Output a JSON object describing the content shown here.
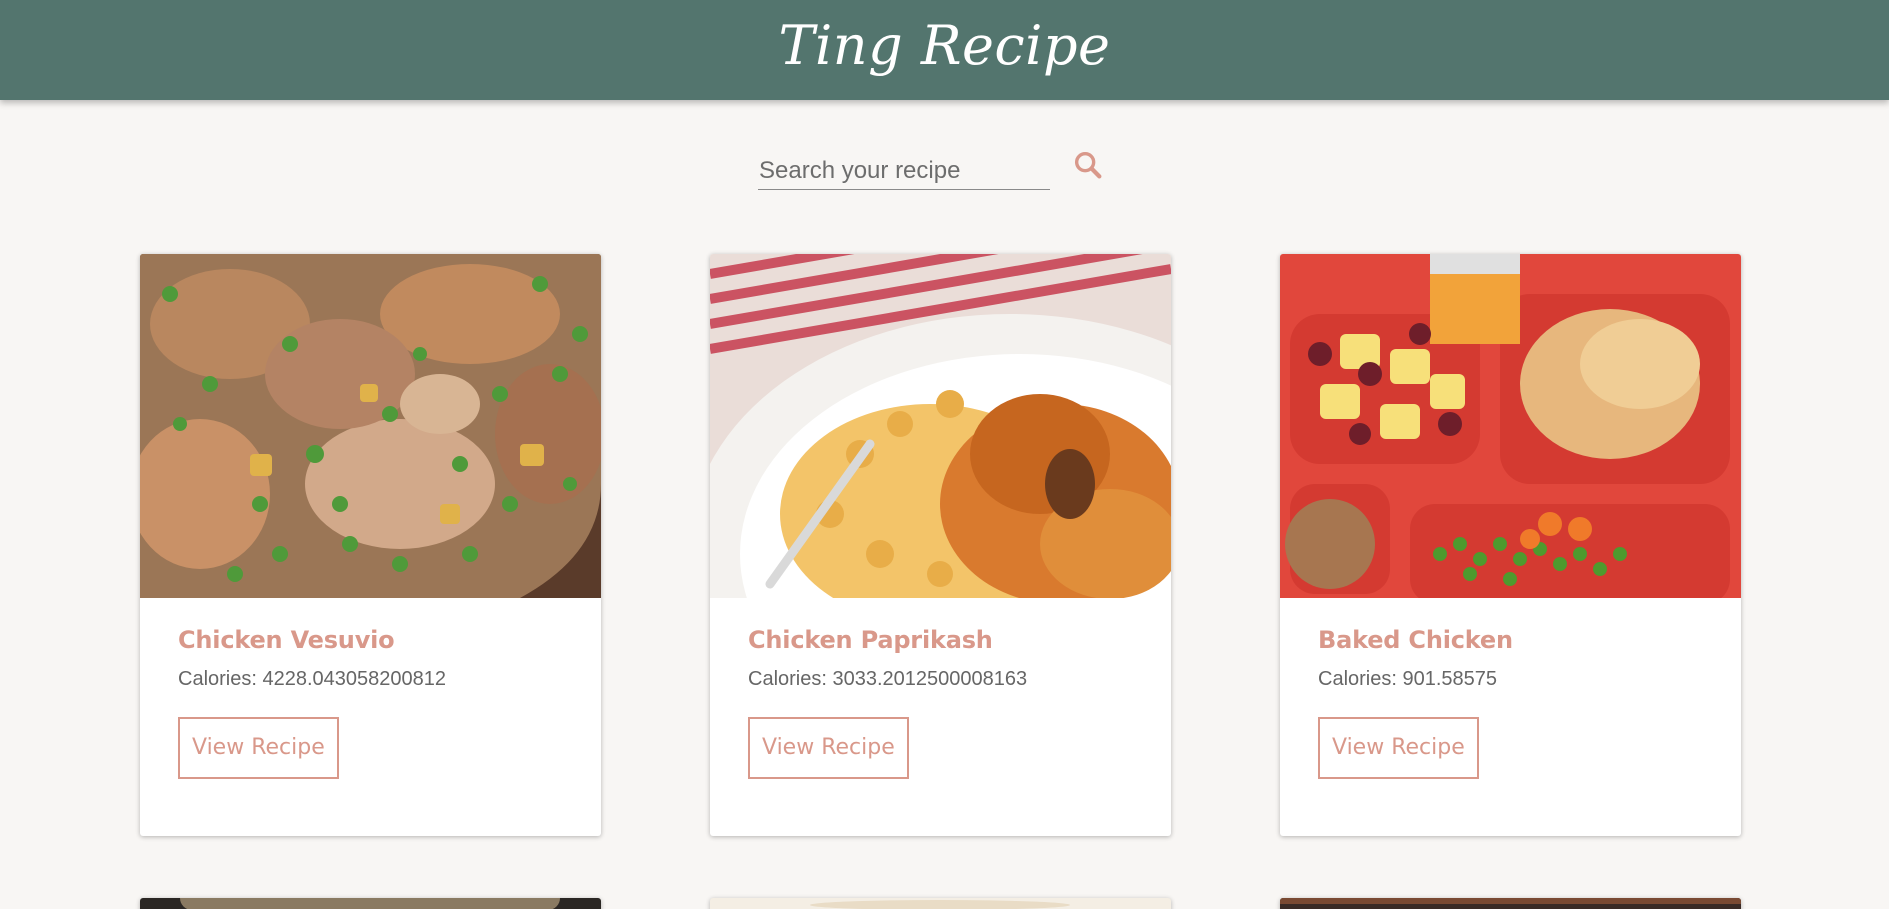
{
  "header": {
    "title": "Ting Recipe"
  },
  "search": {
    "placeholder": "Search your recipe",
    "value": ""
  },
  "recipes": [
    {
      "name": "Chicken Vesuvio",
      "calories": "Calories: 4228.043058200812",
      "button": "View Recipe"
    },
    {
      "name": "Chicken Paprikash",
      "calories": "Calories: 3033.2012500008163",
      "button": "View Recipe"
    },
    {
      "name": "Baked Chicken",
      "calories": "Calories: 901.58575",
      "button": "View Recipe"
    }
  ],
  "colors": {
    "header": "#53756e",
    "accent": "#d9988a",
    "background": "#f8f6f4"
  },
  "icons": {
    "search": "search-icon"
  }
}
